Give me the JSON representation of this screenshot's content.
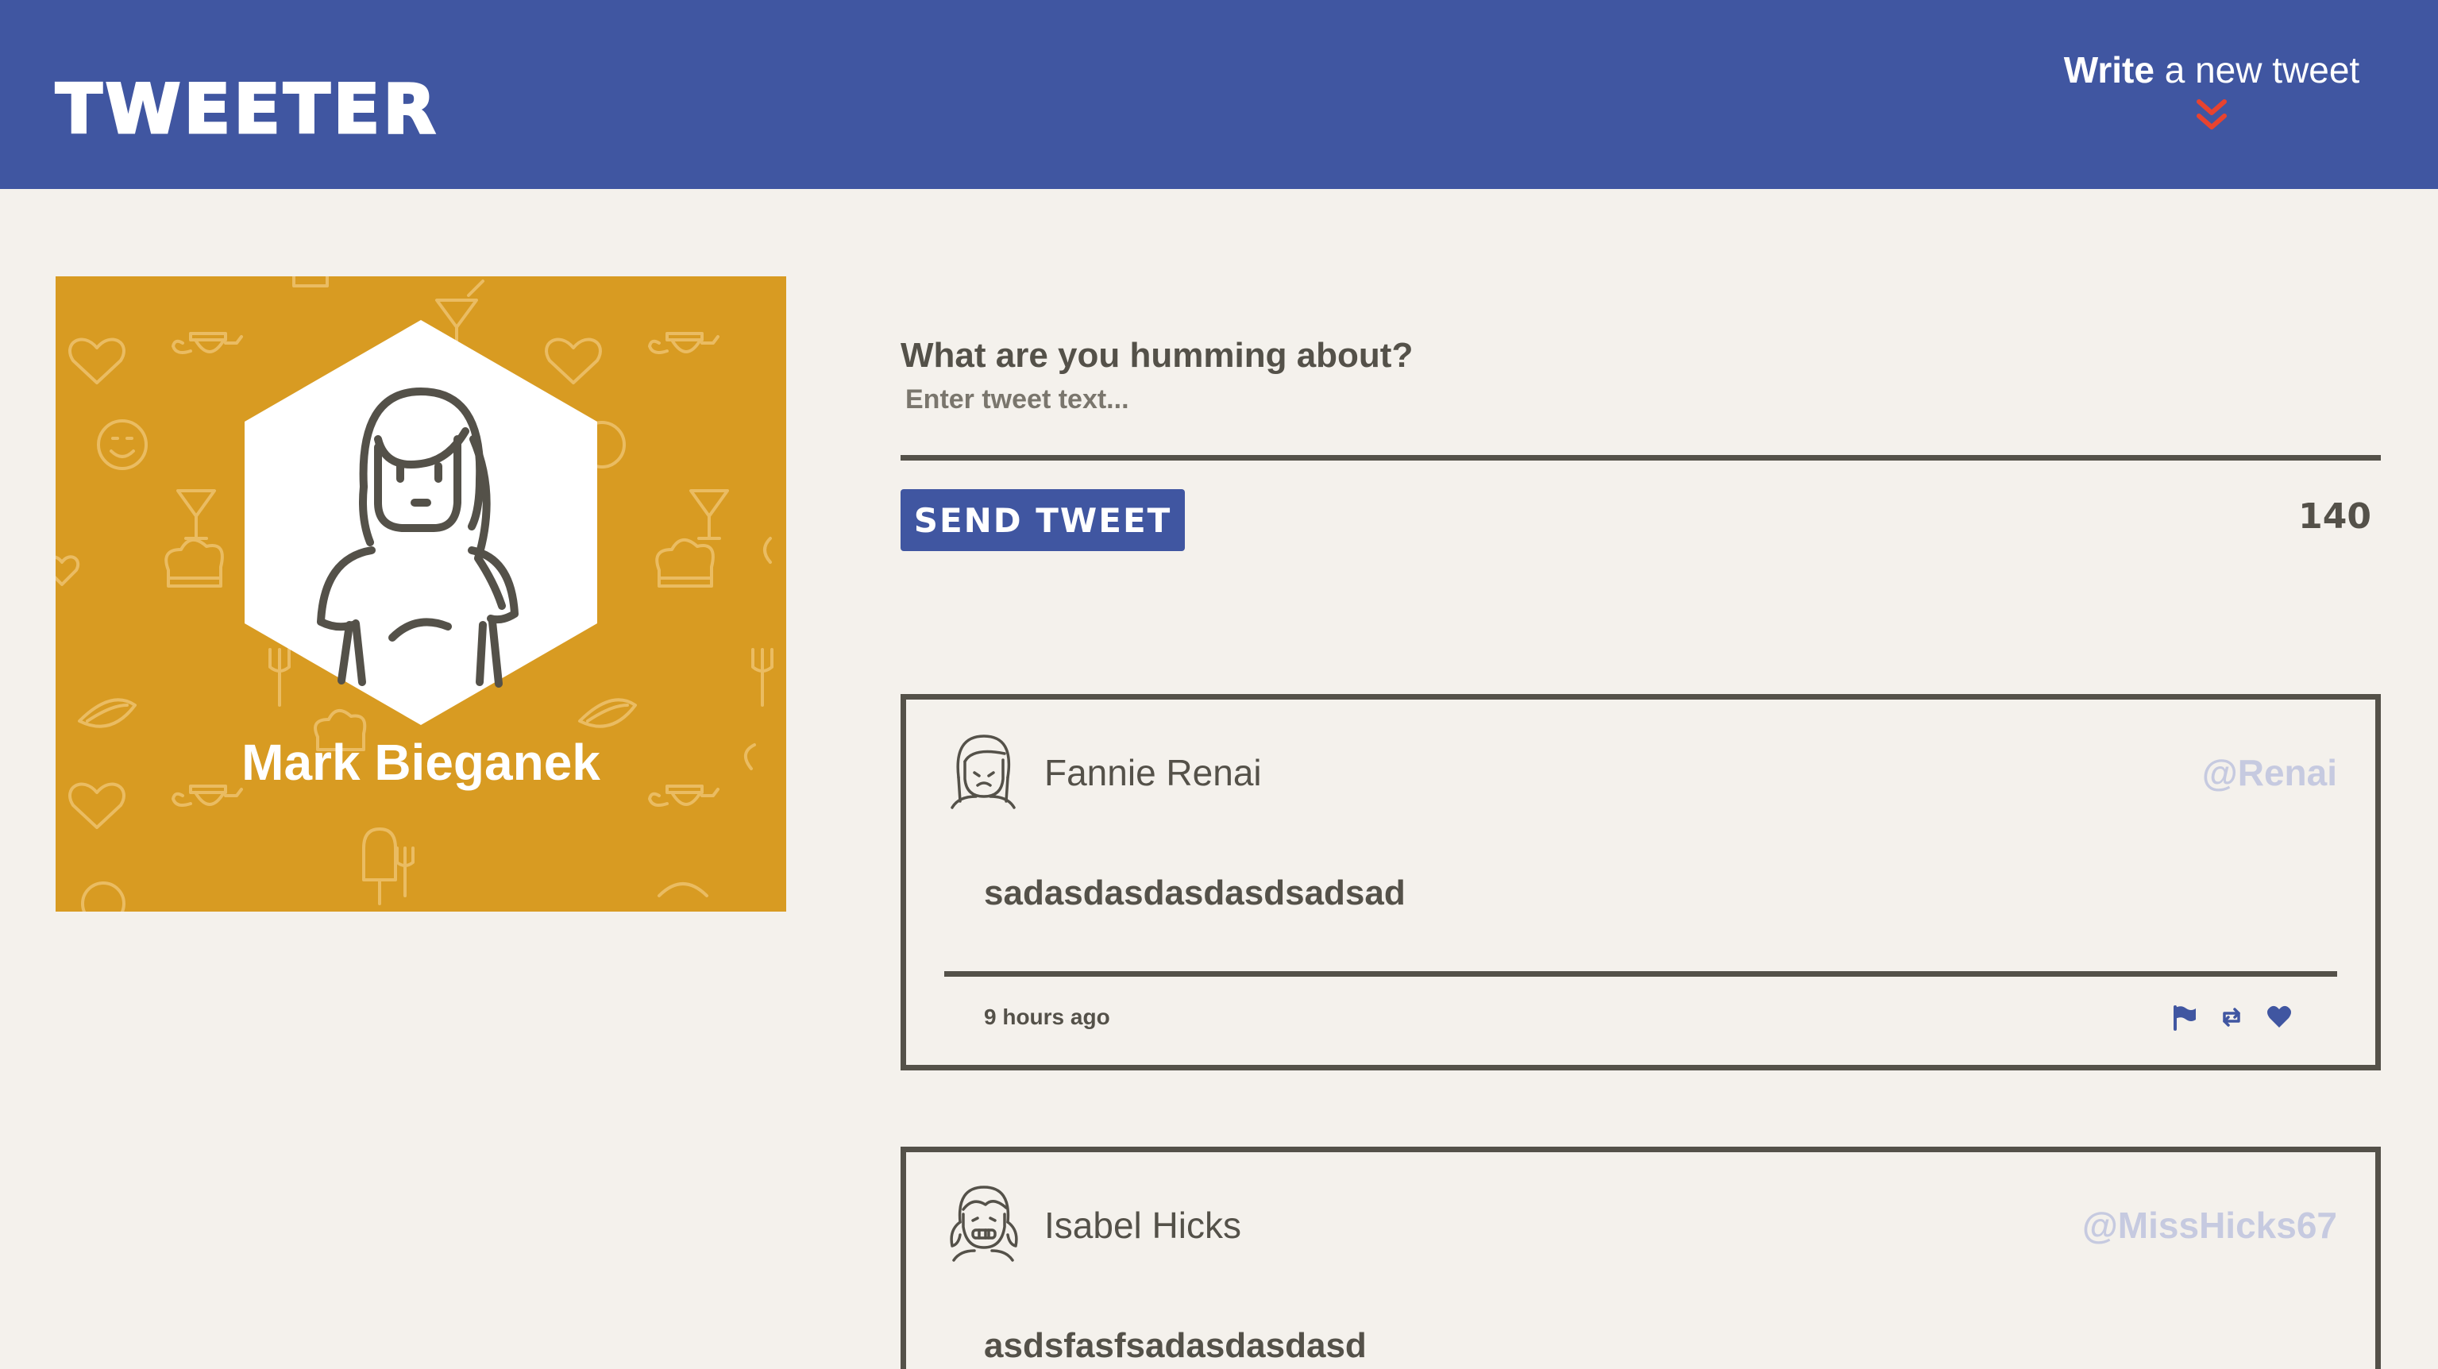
{
  "nav": {
    "brand": "TWEETER",
    "compose_bold": "Write",
    "compose_rest": " a new tweet",
    "compose_icon": "double-chevron-down-icon",
    "accent": "#e8432f",
    "bg": "#4056a1"
  },
  "profile": {
    "name": "Mark Bieganek",
    "bg": "#d89b22",
    "avatar_icon": "user-avatar-icon"
  },
  "composer": {
    "label": "What are you humming about?",
    "placeholder": "Enter tweet text...",
    "button_label": "SEND TWEET",
    "counter": "140"
  },
  "tweets": [
    {
      "name": "Fannie Renai",
      "handle": "@Renai",
      "content": "sadasdasdasdasdsadsad",
      "time": "9 hours ago",
      "actions": [
        "flag-icon",
        "retweet-icon",
        "heart-icon"
      ]
    },
    {
      "name": "Isabel Hicks",
      "handle": "@MissHicks67",
      "content": "asdsfasfsadasdasdasd"
    }
  ]
}
